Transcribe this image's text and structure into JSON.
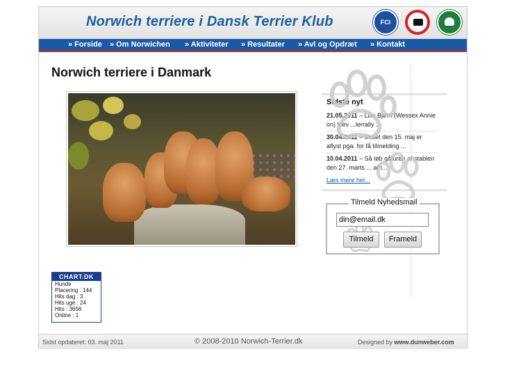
{
  "header": {
    "site_title": "Norwich terriere i Dansk Terrier Klub",
    "logos": [
      {
        "name": "FCI",
        "text": "FCI"
      },
      {
        "name": "Dansk Kennel Klub",
        "text": ""
      },
      {
        "name": "Dansk Terrier Klub",
        "text": ""
      }
    ]
  },
  "nav": {
    "items": [
      "» Forside",
      "» Om Norwichen",
      "» Aktiviteter",
      "» Resultater",
      "» Avl og Opdræt",
      "» Kontakt"
    ]
  },
  "main": {
    "title": "Norwich terriere i Danmark"
  },
  "news": {
    "heading": "Sidste nyt",
    "items": [
      {
        "date": "21.05.2011",
        "text": " – Lille Bjørn (Wessex Annie on) blev ...lerrally ..."
      },
      {
        "date": "30.04.2011",
        "text": " – Skuet den 15. maj er aflyst pga. for få tilmelding ..."
      },
      {
        "date": "10.04.2011",
        "text": " – Så løb gåturen af stablen den 27. marts ... afri..."
      }
    ],
    "more_link": "Læs mere her..."
  },
  "newsletter": {
    "legend": "Tilmeld Nyhedsmail",
    "email_value": "din@email.dk",
    "subscribe_label": "Tilmeld",
    "unsubscribe_label": "Frameld"
  },
  "counter": {
    "title": "CHART.DK",
    "lines": [
      "Hunde",
      "Placering : 144",
      "Hits dag : 3",
      "Hits uge : 24",
      "Hits : 3658",
      "Online : 1"
    ]
  },
  "footer": {
    "updated": "Sidst opdateret: 03. maj 2011",
    "copyright": "© 2008-2010 Norwich-Terrier.dk",
    "designed_by_prefix": "Designed by ",
    "designed_by_link": "www.dunweber.com"
  },
  "colors": {
    "title_blue": "#1c5f9f",
    "nav_blue": "#1a5aa4",
    "nav_border_red": "#d42a2a",
    "counter_blue": "#1a3d8f"
  }
}
